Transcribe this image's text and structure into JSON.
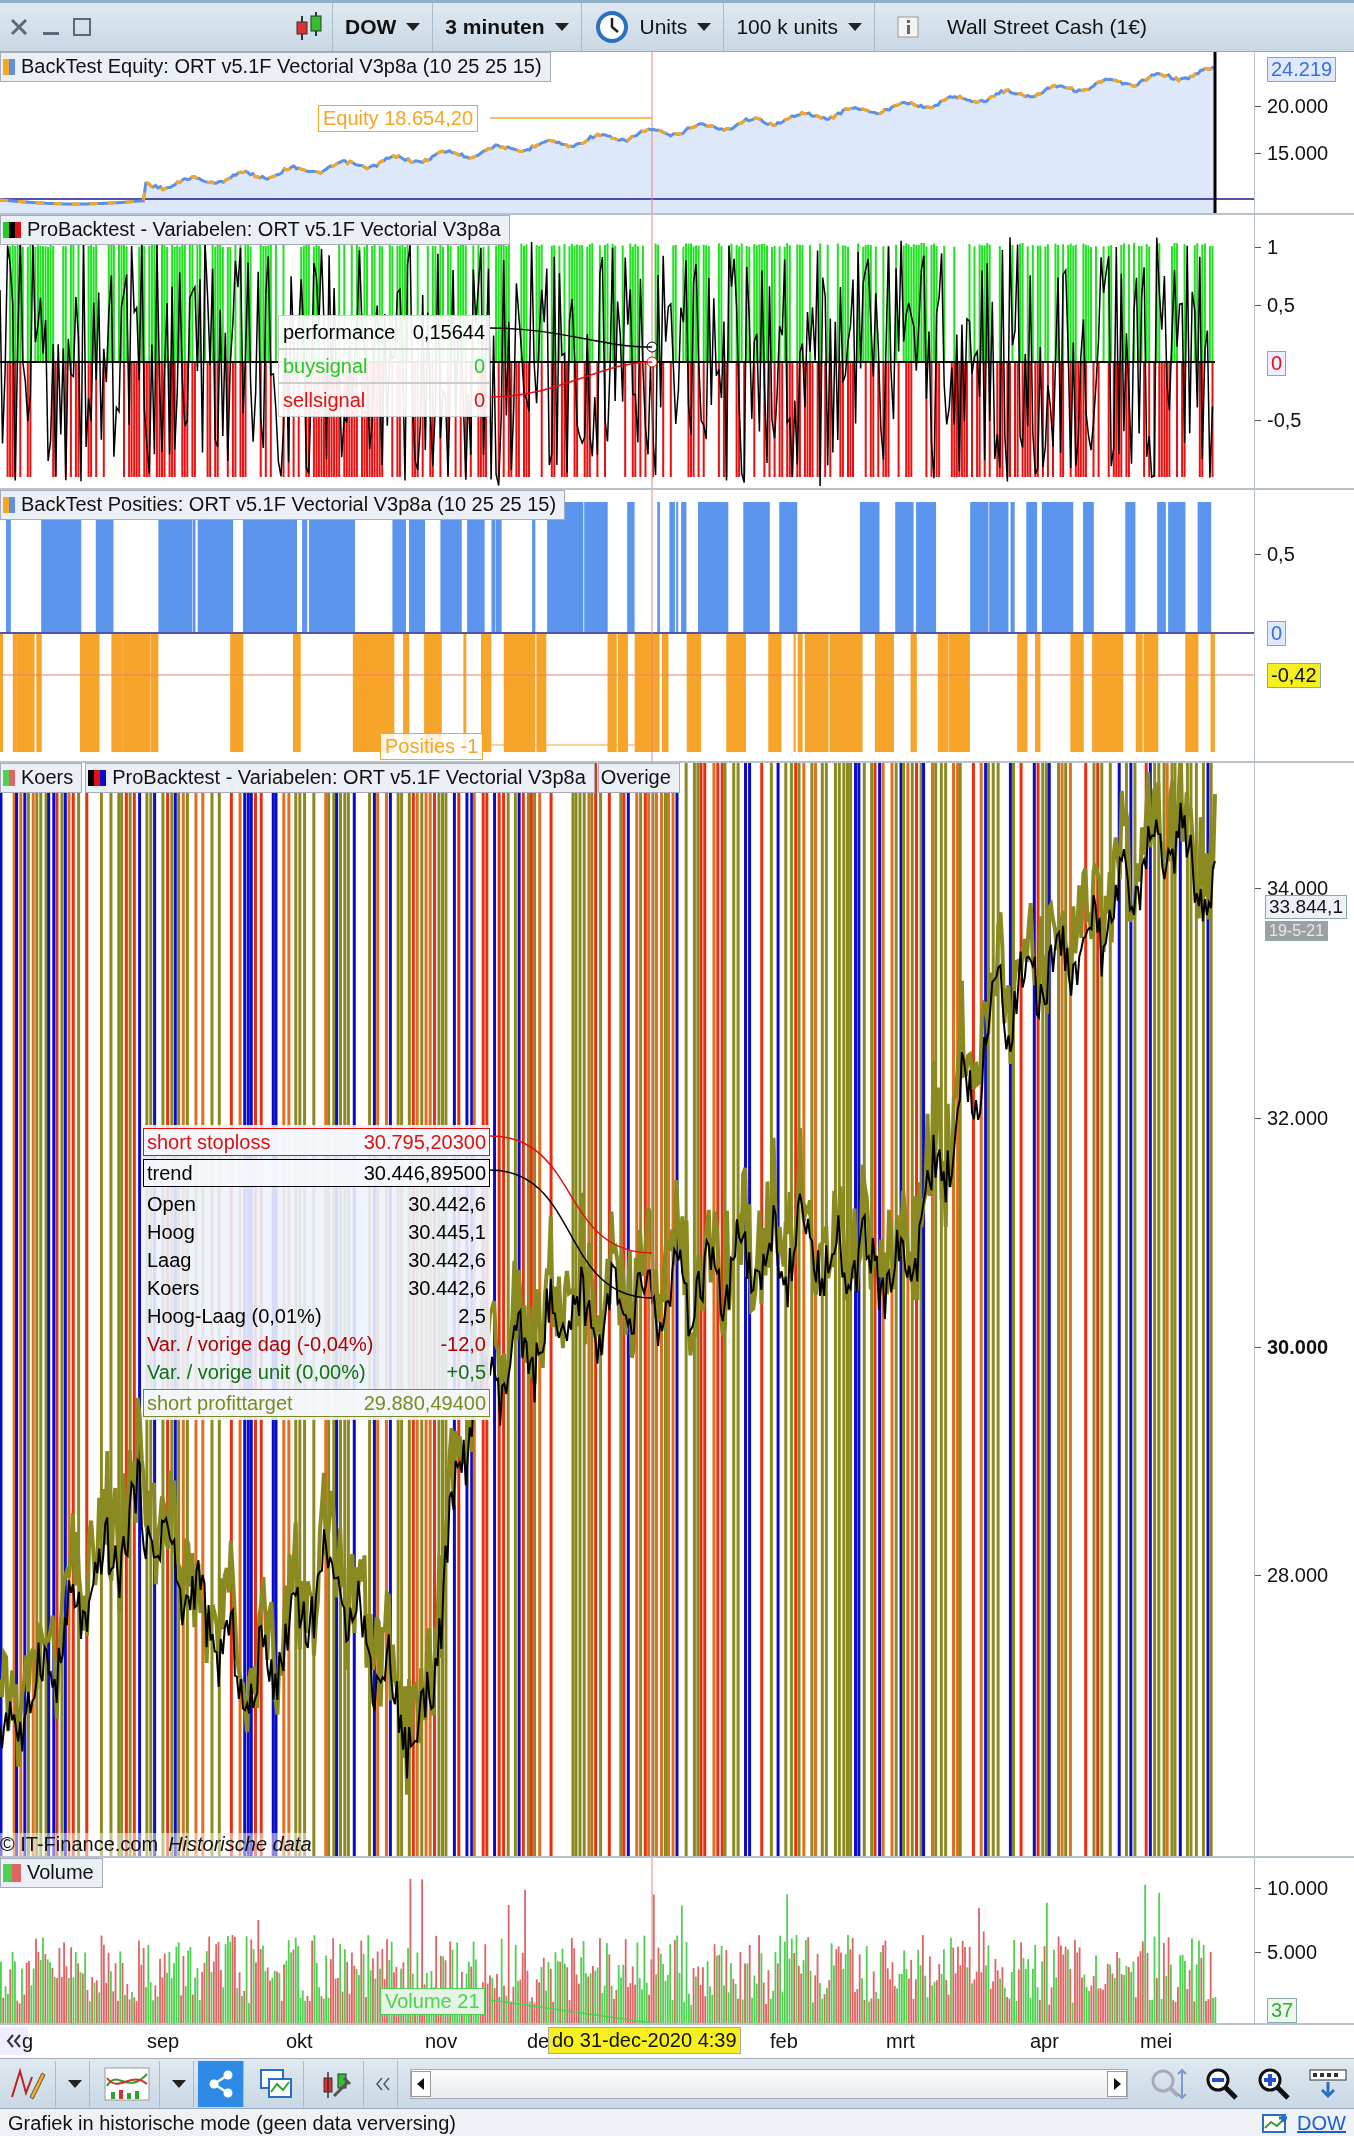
{
  "toolbar": {
    "instrument": "DOW",
    "timeframe": "3 minuten",
    "mode": "Units",
    "size": "100 k units",
    "product": "Wall Street Cash (1€)"
  },
  "equity_panel": {
    "legend": "BackTest Equity: ORT v5.1F Vectorial V3p8a (10 25 25 15)",
    "cursor_label": "Equity  18.654,20",
    "last_value": "24.219",
    "ticks": [
      "20.000",
      "15.000"
    ]
  },
  "variables_panel": {
    "legend": "ProBacktest - Variabelen: ORT v5.1F Vectorial V3p8a",
    "ticks": [
      "1",
      "0,5",
      "-0,5"
    ],
    "last_value": "0",
    "tooltip": [
      {
        "label": "performance",
        "value": "0,15644",
        "color": "#000000"
      },
      {
        "label": "buysignal",
        "value": "0",
        "color": "#22cc22"
      },
      {
        "label": "sellsignal",
        "value": "0",
        "color": "#e01010"
      }
    ]
  },
  "positions_panel": {
    "legend": "BackTest Posities: ORT v5.1F Vectorial V3p8a (10 25 25 15)",
    "ticks": [
      "0,5"
    ],
    "zero_value": "0",
    "last_value": "-0,42",
    "cursor_label": "Posities  -1"
  },
  "price_panel": {
    "legends": [
      "Koers",
      "ProBacktest - Variabelen: ORT v5.1F Vectorial V3p8a",
      "Overige"
    ],
    "ticks": [
      {
        "label": "34.000",
        "bold": false
      },
      {
        "label": "32.000",
        "bold": false
      },
      {
        "label": "30.000",
        "bold": true
      },
      {
        "label": "28.000",
        "bold": false
      }
    ],
    "last_value": "33.844,1",
    "last_date": "19-5-21",
    "tooltip": [
      {
        "label": "short stoploss",
        "value": "30.795,20300",
        "color": "#e01010",
        "boxed": true
      },
      {
        "label": "trend",
        "value": "30.446,89500",
        "color": "#000000",
        "boxed": true
      },
      {
        "label": "Open",
        "value": "30.442,6",
        "color": "#000000",
        "boxed": false
      },
      {
        "label": "Hoog",
        "value": "30.445,1",
        "color": "#000000",
        "boxed": false
      },
      {
        "label": "Laag",
        "value": "30.442,6",
        "color": "#000000",
        "boxed": false
      },
      {
        "label": "Koers",
        "value": "30.442,6",
        "color": "#000000",
        "boxed": false
      },
      {
        "label": "Hoog-Laag (0,01%)",
        "value": "2,5",
        "color": "#000000",
        "boxed": false
      },
      {
        "label": "Var. / vorige dag (-0,04%)",
        "value": "-12,0",
        "color": "#b00000",
        "boxed": false
      },
      {
        "label": "Var. / vorige unit (0,00%)",
        "value": "+0,5",
        "color": "#107010",
        "boxed": false
      },
      {
        "label": "short profittarget",
        "value": "29.880,49400",
        "color": "#7a8a20",
        "boxed": true
      }
    ],
    "copyright": "© IT-Finance.com",
    "data_mode": "Historische data"
  },
  "volume_panel": {
    "legend": "Volume",
    "ticks": [
      "10.000",
      "5.000"
    ],
    "last_value": "37",
    "cursor_label": "Volume  21"
  },
  "time_axis": {
    "months": [
      "g",
      "sep",
      "okt",
      "nov",
      "de",
      "feb",
      "mrt",
      "apr",
      "mei"
    ],
    "cursor_label": "do 31-dec-2020 4:39"
  },
  "status_bar": {
    "message": "Grafiek in historische mode (geen data verversing)",
    "link": "DOW"
  }
}
